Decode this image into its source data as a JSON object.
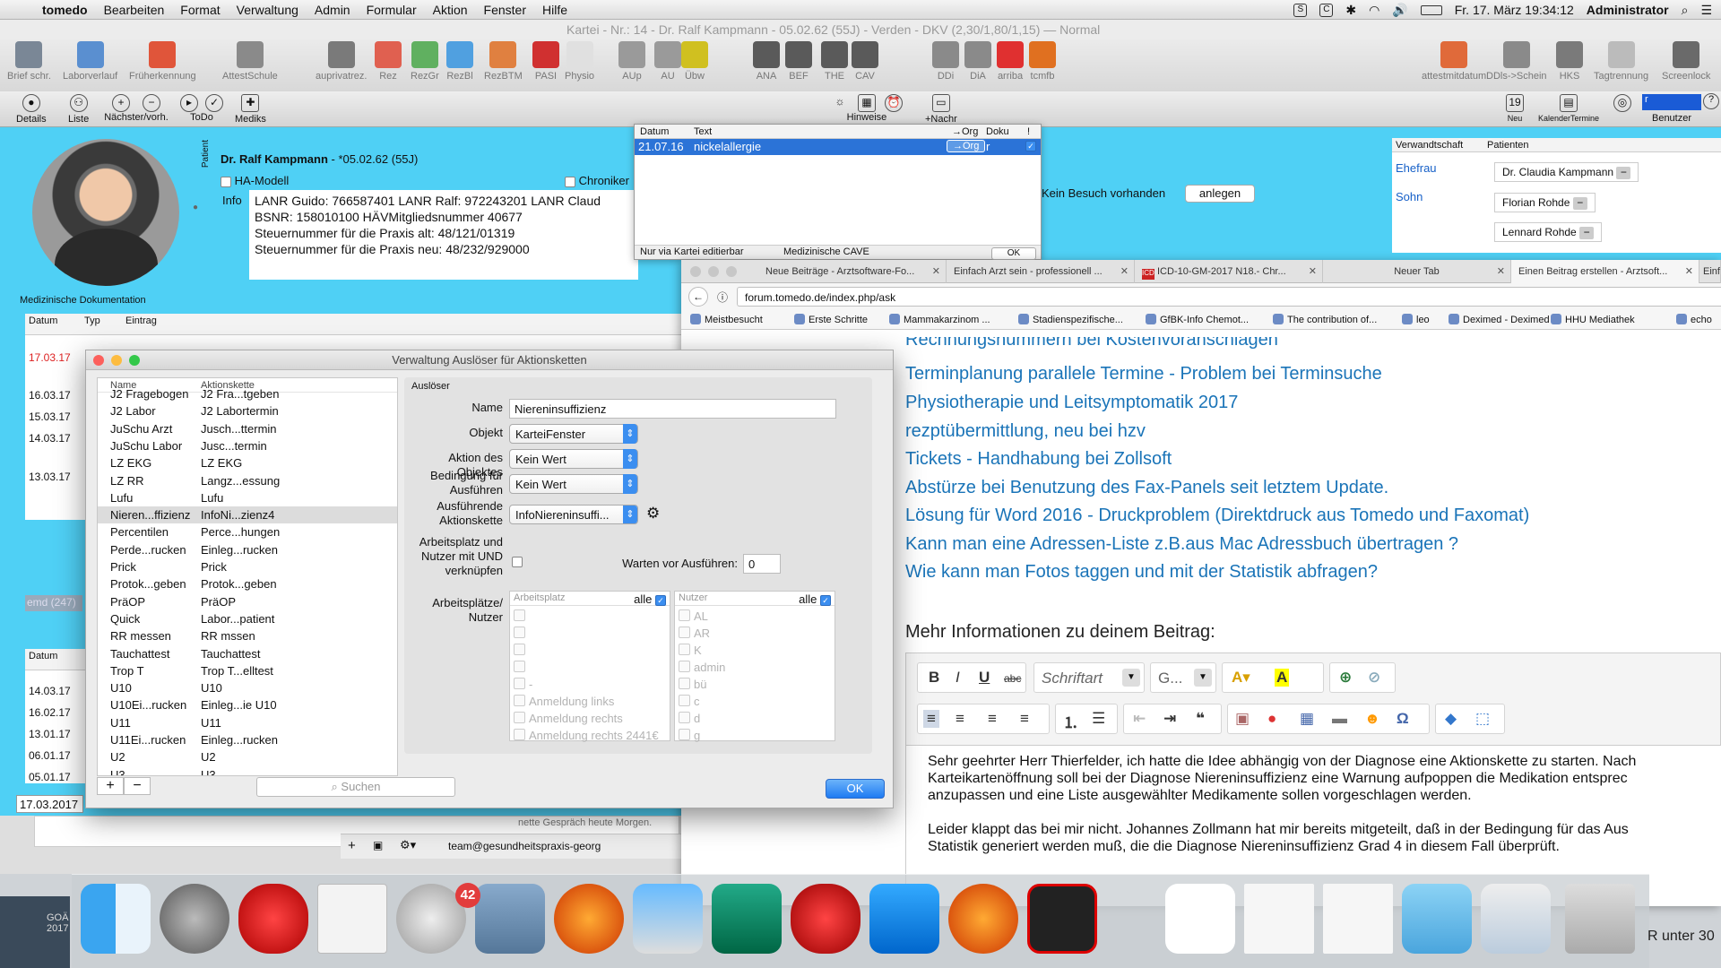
{
  "menubar": {
    "app": "tomedo",
    "menus": [
      "Bearbeiten",
      "Format",
      "Verwaltung",
      "Admin",
      "Formular",
      "Aktion",
      "Fenster",
      "Hilfe"
    ],
    "datetime": "Fr. 17. März  19:34:12",
    "user": "Administrator"
  },
  "window_title": "Kartei - Nr.: 14 - Dr. Ralf Kampmann - 05.02.62 (55J) - Verden - DKV (2,30/1,80/1,15)  —  Normal",
  "toolbar": {
    "items": [
      "Brief schr.",
      "Laborverlauf",
      "Früherkennung",
      "AttestSchule",
      "auprivatrez.",
      "Rez",
      "RezGr",
      "RezBl",
      "RezBTM",
      "PASI",
      "Physio",
      "AUp",
      "AU",
      "Übw",
      "ANA",
      "BEF",
      "THE",
      "CAV",
      "DDi",
      "DiA",
      "arriba",
      "tcmfb",
      "attestmitdatum",
      "DDls->Schein",
      "HKS",
      "Tagtrennung",
      "Screenlock"
    ]
  },
  "toolbar2": {
    "left": [
      "Details",
      "Liste",
      "Nächster/vorh.",
      "ToDo",
      "Mediks"
    ],
    "center": [
      "Hinweise",
      "+Nachr"
    ],
    "right": [
      "Neu",
      "KalenderTermine",
      "Benutzer"
    ]
  },
  "patient": {
    "section_label": "Patient",
    "name": "Dr. Ralf Kampmann",
    "dob": " - *05.02.62 (55J)",
    "ha_modell": "HA-Modell",
    "chroniker": "Chroniker",
    "info_label": "Info",
    "info_lines": [
      "LANR Guido: 766587401  LANR Ralf: 972243201   LANR Claud",
      "BSNR: 158010100  HÄVMitgliedsnummer 40677",
      "Steuernummer für die Praxis alt: 48/121/01319",
      "Steuernummer für die Praxis neu: 48/232/929000"
    ],
    "kein_besuch": "Kein Besuch vorhanden",
    "anlegen": "anlegen",
    "med_doc": "Medizinische Dokumentation"
  },
  "cave": {
    "headers": [
      "Datum",
      "Text",
      "→Org",
      "Doku",
      "!"
    ],
    "row": {
      "date": "21.07.16",
      "text": "nickelallergie",
      "org": "→Org",
      "doku": "r"
    },
    "footer_left": "Nur via Kartei editierbar",
    "footer_right": "Medizinische CAVE",
    "ok": "OK"
  },
  "relations": {
    "headers": [
      "Verwandtschaft",
      "Patienten"
    ],
    "rows": [
      {
        "rel": "Ehefrau",
        "name": "Dr. Claudia Kampmann"
      },
      {
        "rel": "Sohn",
        "name": "Florian Rohde"
      },
      {
        "rel": "",
        "name": "Lennard Rohde"
      }
    ]
  },
  "doc_list": {
    "headers": [
      "Datum",
      "Typ",
      "Eintrag"
    ],
    "dates": [
      "17.03.17",
      "16.03.17",
      "15.03.17",
      "14.03.17",
      "13.03.17"
    ]
  },
  "lower_list": {
    "header": "Datum",
    "dates": [
      "14.03.17",
      "16.02.17",
      "13.01.17",
      "06.01.17",
      "05.01.17"
    ],
    "bottom_date": "17.03.2017",
    "emd": "emd (247)",
    "email": "team@gesundheitspraxis-georg",
    "chat_snip": "nette Gespräch heute Morgen."
  },
  "browser": {
    "tabs": [
      "Neue Beiträge - Arztsoftware-Fo...",
      "Einfach Arzt sein - professionell ...",
      "ICD-10-GM-2017 N18.- Chr...",
      "Neuer Tab",
      "Einen Beitrag erstellen - Arztsoft...",
      "Einf"
    ],
    "url": "forum.tomedo.de/index.php/ask",
    "bookmarks": [
      "Meistbesucht",
      "Erste Schritte",
      "Mammakarzinom ...",
      "Stadienspezifische...",
      "GfBK-Info Chemot...",
      "The contribution of...",
      "leo",
      "Deximed - Deximed",
      "HHU Mediathek",
      "echo"
    ],
    "links": [
      "Rechnungsnummern bei Kostenvoranschlägen",
      "Terminplanung parallele Termine - Problem bei Terminsuche",
      "Physiotherapie und Leitsymptomatik 2017",
      "rezptübermittlung, neu bei hzv",
      "Tickets - Handhabung bei Zollsoft",
      "Abstürze bei Benutzung des Fax-Panels seit letztem Update.",
      "Lösung für Word 2016 - Druckproblem (Direktdruck aus Tomedo und Faxomat)",
      "Kann man eine Adressen-Liste z.B.aus Mac Adressbuch übertragen ?",
      "Wie kann man Fotos taggen und mit der Statistik abfragen?"
    ],
    "mehr": "Mehr Informationen zu deinem Beitrag:",
    "font_select": "Schriftart",
    "size_select": "G...",
    "editor_lines": [
      "Sehr geehrter Herr Thierfelder, ich hatte die Idee abhängig von der Diagnose eine Aktionskette zu starten. Nach",
      "Karteikartenöffnung soll bei der Diagnose Niereninsuffizienz eine Warnung aufpoppen  die Medikation entsprec",
      "anzupassen und eine Liste ausgewählter Medikamente sollen vorgeschlagen werden.",
      "",
      "Leider klappt das bei mir nicht. Johannes Zollmann hat mir bereits mitgeteilt, daß in der Bedingung für das Aus",
      "Statistik generiert werden muß, die die Diagnose Niereninsuffizienz Grad 4 in diesem Fall überprüft."
    ]
  },
  "dialog": {
    "title": "Verwaltung Auslöser für Aktionsketten",
    "list_headers": [
      "Name",
      "Aktionskette"
    ],
    "rows": [
      [
        "J2 Fragebogen",
        "J2 Fra...tgeben"
      ],
      [
        "J2 Labor",
        "J2 Labortermin"
      ],
      [
        "JuSchu Arzt",
        "Jusch...ttermin"
      ],
      [
        "JuSchu Labor",
        "Jusc...termin"
      ],
      [
        "LZ EKG",
        "LZ EKG"
      ],
      [
        "LZ RR",
        "Langz...essung"
      ],
      [
        "Lufu",
        "Lufu"
      ],
      [
        "Nieren...ffizienz",
        "InfoNi...zienz4"
      ],
      [
        "Percentilen",
        "Perce...hungen"
      ],
      [
        "Perde...rucken",
        "Einleg...rucken"
      ],
      [
        "Prick",
        "Prick"
      ],
      [
        "Protok...geben",
        "Protok...geben"
      ],
      [
        "PräOP",
        "PräOP"
      ],
      [
        "Quick",
        "Labor...patient"
      ],
      [
        "RR messen",
        "RR mssen"
      ],
      [
        "Tauchattest",
        "Tauchattest"
      ],
      [
        "Trop T",
        "Trop T...elltest"
      ],
      [
        "U10",
        "U10"
      ],
      [
        "U10Ei...rucken",
        "Einleg...ie U10"
      ],
      [
        "U11",
        "U11"
      ],
      [
        "U11Ei...rucken",
        "Einleg...rucken"
      ],
      [
        "U2",
        "U2"
      ],
      [
        "U3",
        "U3"
      ]
    ],
    "selected_index": 7,
    "search_placeholder": "Suchen",
    "section": "Auslöser",
    "labels": {
      "name": "Name",
      "objekt": "Objekt",
      "aktion": "Aktion des Objektes",
      "bedingung": "Bedingung für Ausführen",
      "kette": "Ausführende Aktionskette",
      "arbeitsplatz": "Arbeitsplatz und Nutzer mit UND verknüpfen",
      "warten": "Warten vor Ausführen:",
      "plaetze": "Arbeitsplätze/ Nutzer"
    },
    "values": {
      "name": "Niereninsuffizienz",
      "objekt": "KarteiFenster",
      "aktion": "Kein Wert",
      "bedingung": "Kein Wert",
      "kette": "InfoNiereninsuffi...",
      "warten": "0"
    },
    "arbeitsplatz_header": "Arbeitsplatz",
    "nutzer_header": "Nutzer",
    "alle": "alle",
    "arbeitsplaetze": [
      "",
      "",
      "",
      "",
      "-",
      "Anmeldung links",
      "Anmeldung rechts",
      "Anmeldung rechts 2441€"
    ],
    "nutzer": [
      "AL",
      "AR",
      "K",
      "admin",
      "bü",
      "c",
      "d",
      "g"
    ],
    "ok": "OK"
  },
  "dock": {
    "badge": "42",
    "left_label": "GOÄ 2017",
    "right_snip": "R unter 30"
  }
}
